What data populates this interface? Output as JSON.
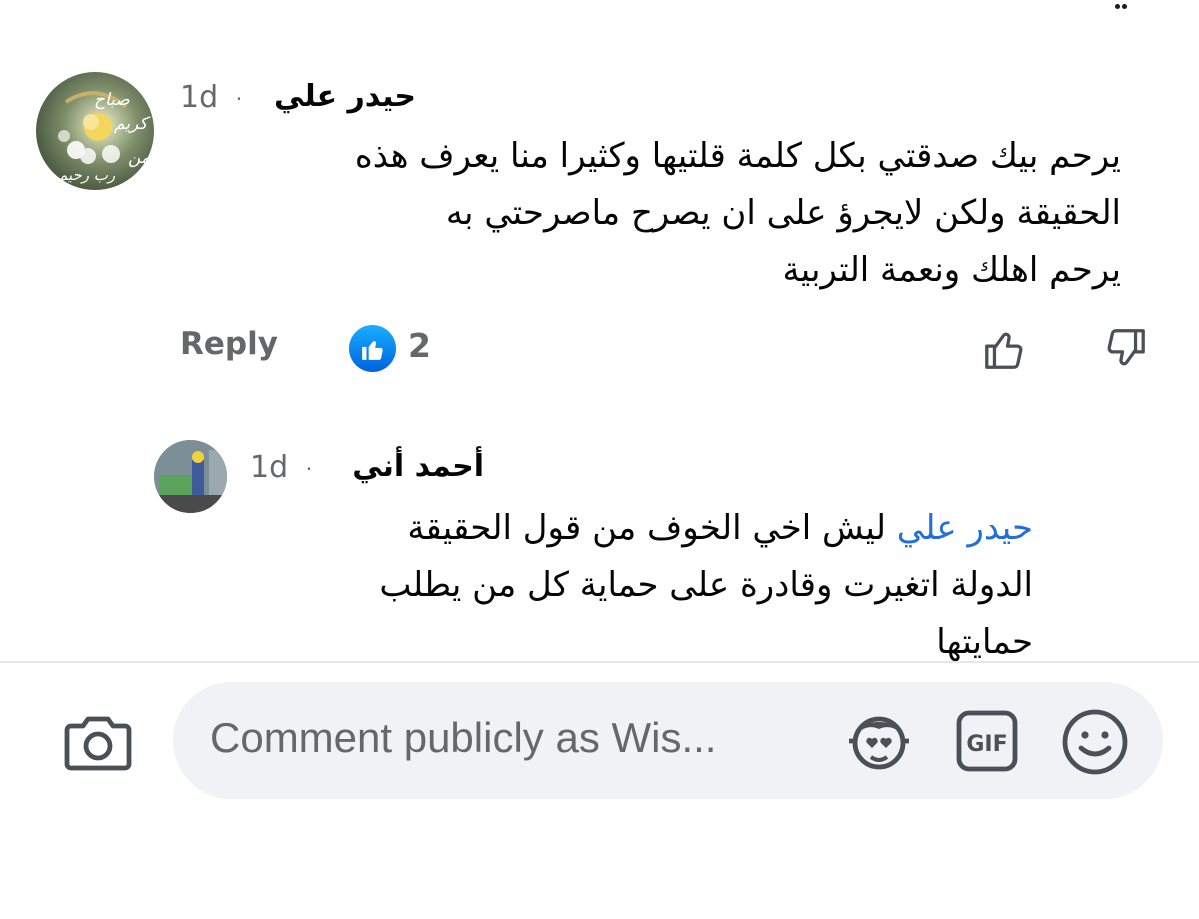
{
  "comments": [
    {
      "author": "حيدر علي",
      "time": "1d",
      "separator": "·",
      "text_lines": [
        "يرحم بيك صدقتي بكل كلمة قلتيها وكثيرا منا يعرف هذه",
        "الحقيقة ولكن لايجرؤ على ان يصرح ماصرحتي به",
        "يرحم اهلك ونعمة التربية"
      ],
      "reply_label": "Reply",
      "like_count": "2"
    },
    {
      "author": "أحمد  أني",
      "time": "1d",
      "separator": "·",
      "mention": "حيدر علي",
      "text_line1_rest": " ليش اخي الخوف من قول الحقيقة",
      "text_lines": [
        "الدولة اتغيرت وقادرة على حماية كل من يطلب",
        "حمايتها"
      ]
    }
  ],
  "avatar_text": {
    "line1": "صباح",
    "line2": "كريم",
    "line3": "من",
    "line4": "رب رحيم"
  },
  "composer": {
    "placeholder": "Comment publicly as Wis..."
  },
  "icons": {
    "like": "thumbs-up-icon",
    "dislike": "thumbs-down-icon",
    "camera": "camera-icon",
    "avatar_sticker": "avatar-sticker-icon",
    "gif": "gif-icon",
    "emoji": "emoji-icon"
  },
  "colors": {
    "mention": "#216fdb",
    "secondary_text": "#65676b",
    "like_blue": "#0866ff",
    "input_bg": "#f0f2f5"
  }
}
